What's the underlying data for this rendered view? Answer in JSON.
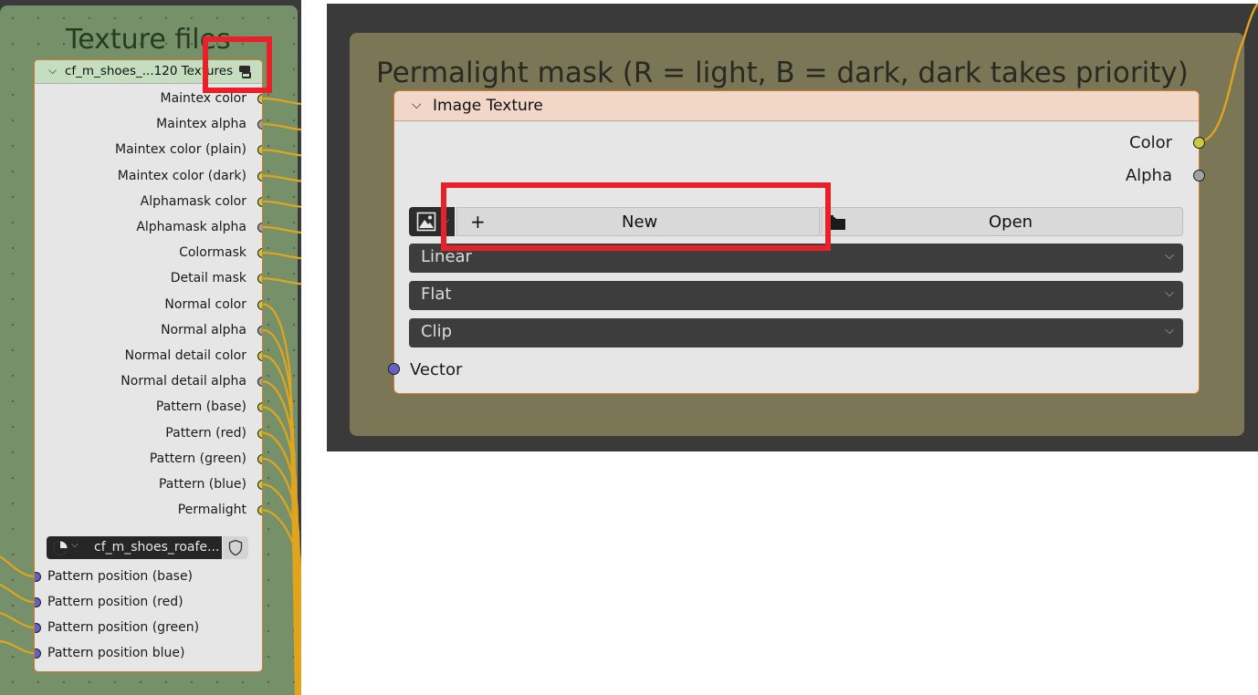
{
  "left": {
    "frame_title": "Texture files",
    "node": {
      "header": "cf_m_shoes_...120 Textures",
      "outputs": [
        {
          "label": "Maintex color",
          "socket": "yellow"
        },
        {
          "label": "Maintex alpha",
          "socket": "gray"
        },
        {
          "label": "Maintex color (plain)",
          "socket": "yellow"
        },
        {
          "label": "Maintex color (dark)",
          "socket": "yellow"
        },
        {
          "label": "Alphamask color",
          "socket": "yellow"
        },
        {
          "label": "Alphamask alpha",
          "socket": "gray"
        },
        {
          "label": "Colormask",
          "socket": "yellow"
        },
        {
          "label": "Detail mask",
          "socket": "yellow"
        },
        {
          "label": "Normal color",
          "socket": "yellow"
        },
        {
          "label": "Normal alpha",
          "socket": "gray"
        },
        {
          "label": "Normal detail color",
          "socket": "yellow"
        },
        {
          "label": "Normal detail alpha",
          "socket": "gray"
        },
        {
          "label": "Pattern (base)",
          "socket": "yellow"
        },
        {
          "label": "Pattern (red)",
          "socket": "yellow"
        },
        {
          "label": "Pattern (green)",
          "socket": "yellow"
        },
        {
          "label": "Pattern (blue)",
          "socket": "yellow"
        },
        {
          "label": "Permalight",
          "socket": "yellow"
        }
      ],
      "datablock_name": "cf_m_shoes_roafe...",
      "inputs": [
        {
          "label": "Pattern position (base)"
        },
        {
          "label": "Pattern position (red)"
        },
        {
          "label": "Pattern position (green)"
        },
        {
          "label": "Pattern position blue)"
        }
      ]
    }
  },
  "right": {
    "frame_title": "Permalight mask (R = light, B = dark, dark takes priority)",
    "node": {
      "header": "Image Texture",
      "outputs": {
        "color": "Color",
        "alpha": "Alpha"
      },
      "new_label": "New",
      "open_label": "Open",
      "plus_glyph": "+",
      "interpolation": "Linear",
      "projection": "Flat",
      "extension": "Clip",
      "vector_input": "Vector"
    }
  },
  "colors": {
    "socket_yellow": "#c9c943",
    "socket_gray": "#a1a1a1",
    "socket_blue": "#6363c7",
    "highlight_red": "#e8202a",
    "node_outline": "#d07a2a",
    "link_orange": "#e0a51c"
  }
}
